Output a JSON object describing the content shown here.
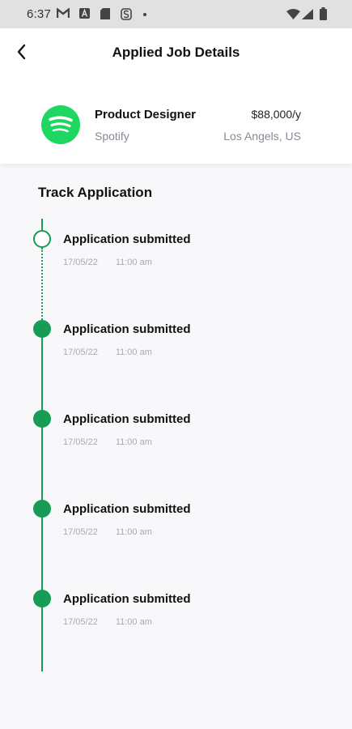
{
  "status_bar": {
    "time": "6:37",
    "icons": [
      "gmail-icon",
      "a-badge-icon",
      "sd-card-icon",
      "s-app-icon",
      "wifi-icon",
      "signal-icon",
      "battery-icon"
    ]
  },
  "header": {
    "title": "Applied Job Details",
    "back_icon": "chevron-left-icon"
  },
  "job": {
    "title": "Product Designer",
    "company": "Spotify",
    "salary": "$88,000/y",
    "location": "Los Angels, US",
    "logo_icon": "spotify-logo-icon",
    "logo_color": "#1ed760"
  },
  "track": {
    "title": "Track Application",
    "accent_color": "#169c55",
    "steps": [
      {
        "label": "Application submitted",
        "date": "17/05/22",
        "time": "11:00 am",
        "state": "pending"
      },
      {
        "label": "Application submitted",
        "date": "17/05/22",
        "time": "11:00 am",
        "state": "done"
      },
      {
        "label": "Application submitted",
        "date": "17/05/22",
        "time": "11:00 am",
        "state": "done"
      },
      {
        "label": "Application submitted",
        "date": "17/05/22",
        "time": "11:00 am",
        "state": "done"
      },
      {
        "label": "Application submitted",
        "date": "17/05/22",
        "time": "11:00 am",
        "state": "done"
      }
    ]
  }
}
